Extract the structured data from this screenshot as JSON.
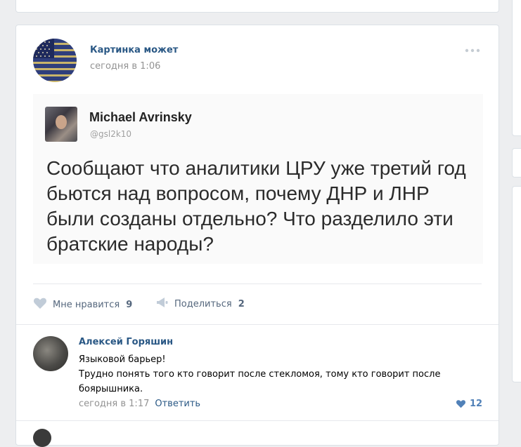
{
  "post": {
    "group_name": "Картинка может",
    "time": "сегодня в 1:06",
    "attachment": {
      "author_name": "Michael Avrinsky",
      "author_handle": "@gsl2k10",
      "text": "Сообщают что аналитики ЦРУ уже третий год бьются над вопросом, почему ДНР и ЛНР были созданы отдельно? Что разделило эти братские народы?"
    },
    "actions": {
      "like_label": "Мне нравится",
      "like_count": "9",
      "share_label": "Поделиться",
      "share_count": "2"
    }
  },
  "comment": {
    "author": "Алексей Горяшин",
    "line1": "Языковой барьер!",
    "line2": "Трудно понять того кто говорит после стекломоя, тому кто говорит после боярышника.",
    "time": "сегодня в 1:17",
    "reply_label": "Ответить",
    "like_count": "12"
  },
  "icons": {
    "more": "more-dots-icon",
    "like": "heart-icon",
    "share": "megaphone-icon"
  },
  "colors": {
    "link": "#2a5885",
    "muted": "#939393",
    "action": "#55677d",
    "like_active": "#5181b8",
    "background": "#edeef0"
  }
}
